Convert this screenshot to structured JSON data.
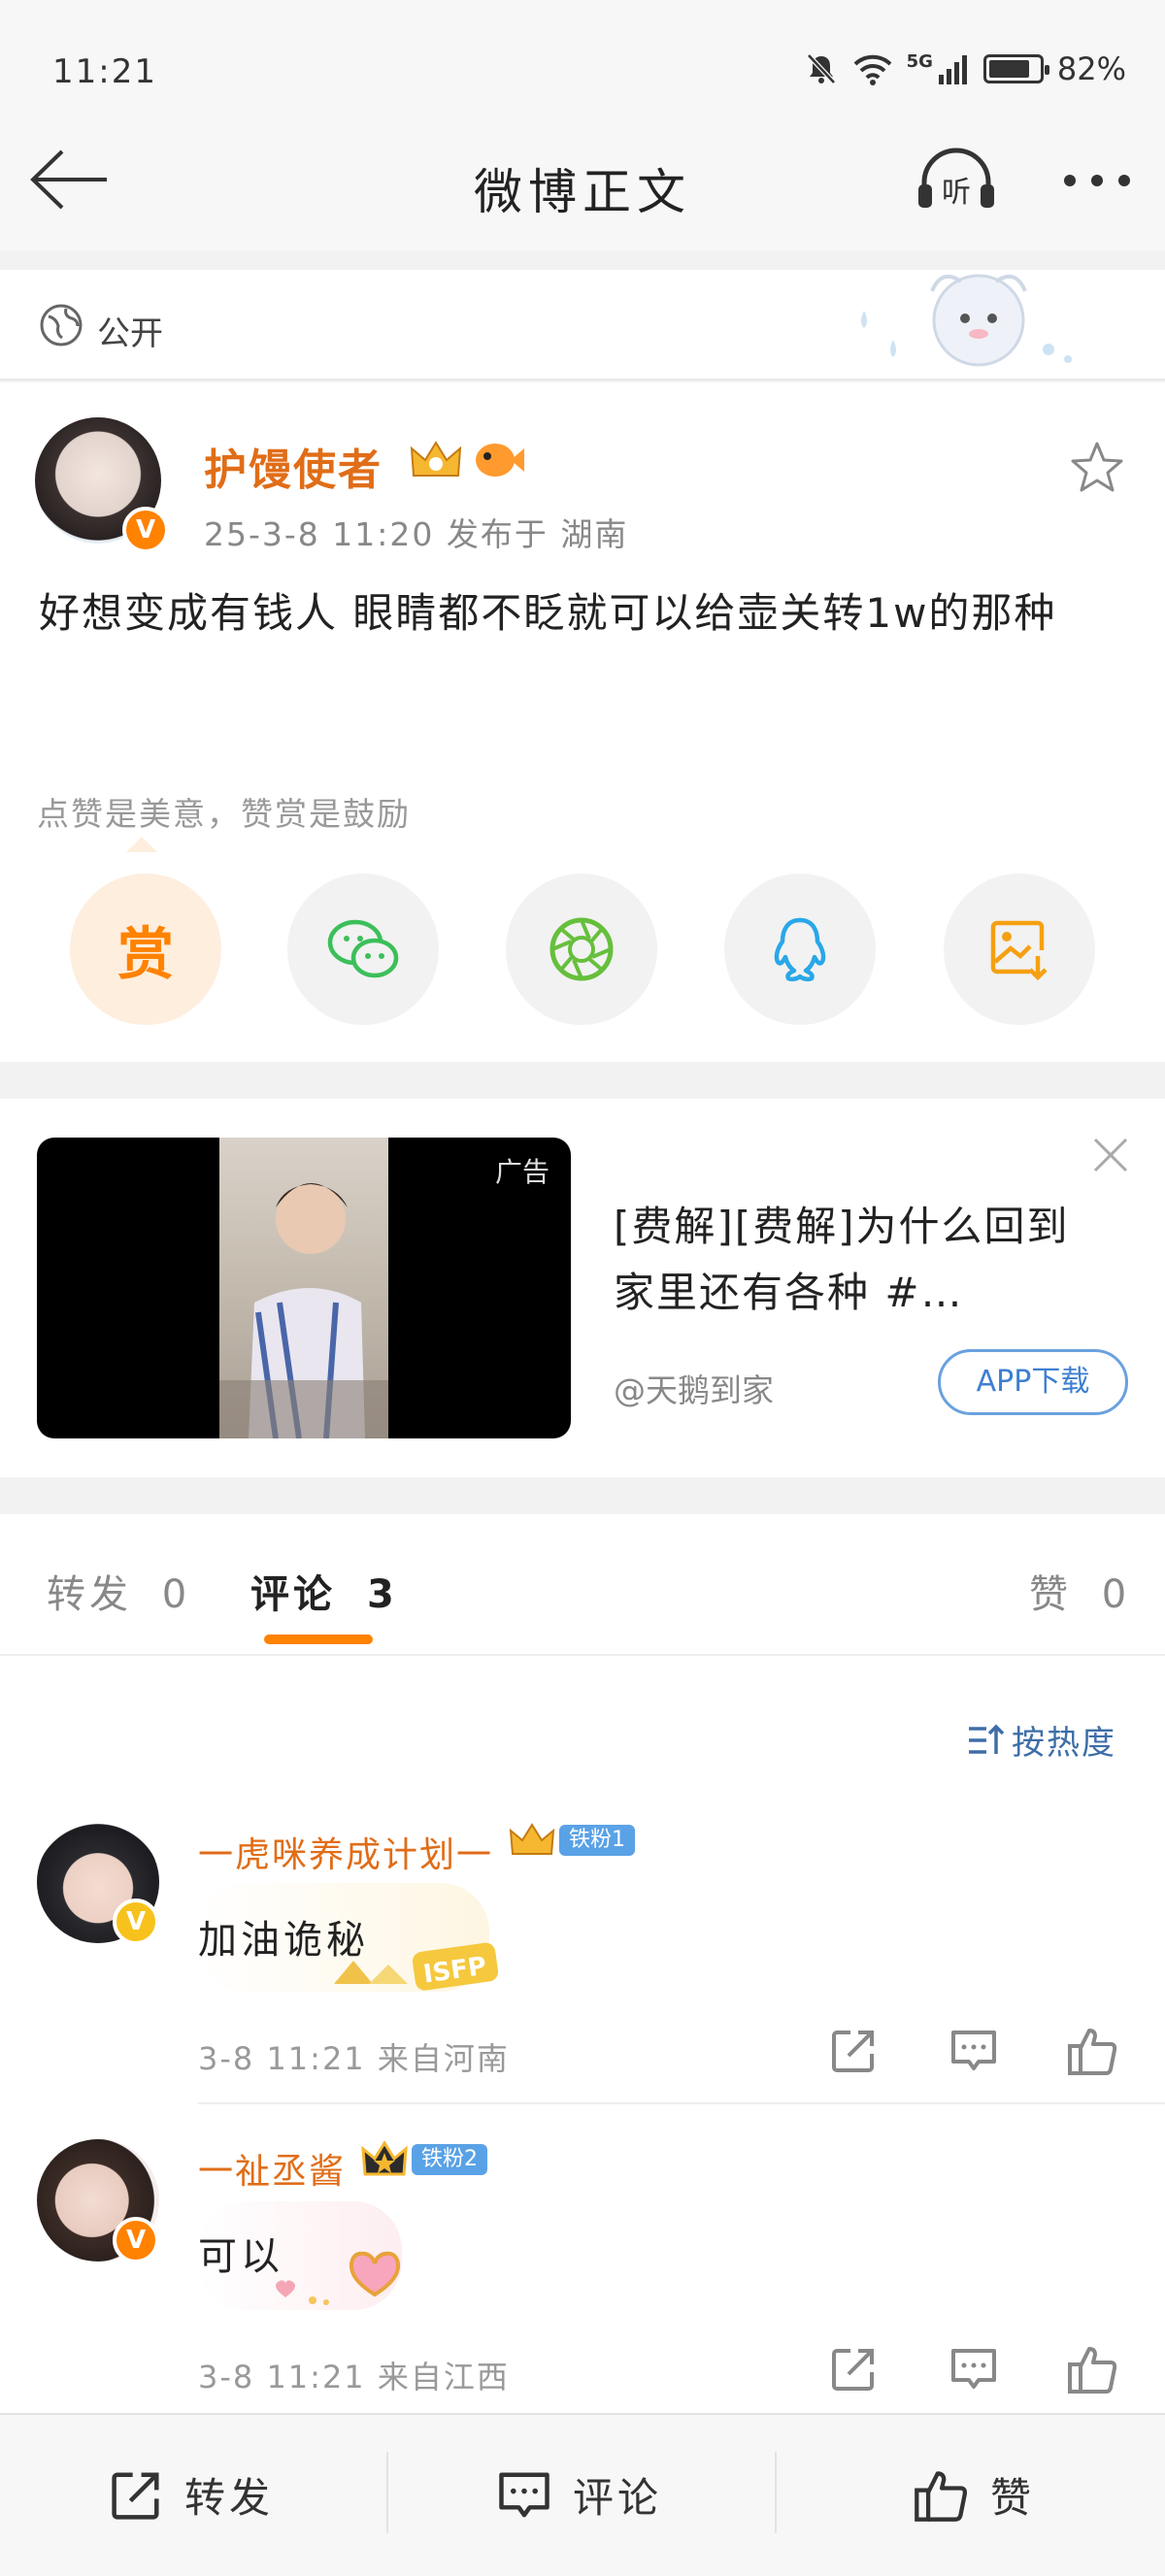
{
  "status_bar": {
    "time": "11:21",
    "network": "5G",
    "battery_text": "82%",
    "battery_level": 0.82
  },
  "nav": {
    "title": "微博正文",
    "listen_label": "听"
  },
  "visibility": {
    "label": "公开"
  },
  "post": {
    "author": "护馒使者",
    "meta": "25-3-8 11:20  发布于 湖南",
    "text": "好想变成有钱人 眼睛都不眨就可以给壶关转1w的那种",
    "reward_tip": "点赞是美意，赞赏是鼓励",
    "reward_label": "赏"
  },
  "ad": {
    "tag": "广告",
    "text": "[费解][费解]为什么回到家里还有各种 #…",
    "source": "@天鹅到家",
    "button": "APP下载"
  },
  "tabs": [
    {
      "label": "转发",
      "count": "0"
    },
    {
      "label": "评论",
      "count": "3"
    },
    {
      "label": "赞",
      "count": "0"
    }
  ],
  "sort_label": "按热度",
  "comments": [
    {
      "name": "一虎咪养成计划一",
      "fan_badge": "铁粉1",
      "text": "加油诡秘",
      "meta": "3-8 11:21  来自河南"
    },
    {
      "name": "一祉丞酱",
      "fan_badge": "铁粉2",
      "text": "可以",
      "meta": "3-8 11:21  来自江西"
    }
  ],
  "bottom_bar": {
    "repost": "转发",
    "comment": "评论",
    "like": "赞"
  },
  "colors": {
    "accent": "#ff8200",
    "name": "#e06d18",
    "link": "#3e6ea8"
  }
}
